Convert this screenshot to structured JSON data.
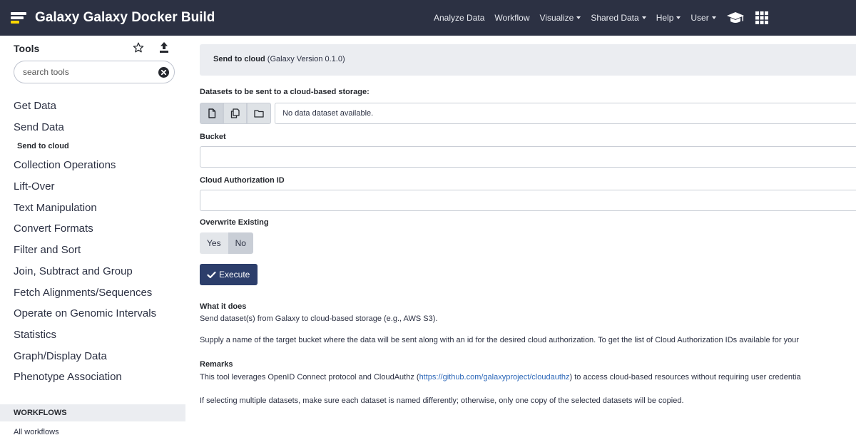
{
  "topbar": {
    "title": "Galaxy Galaxy Docker Build",
    "logo_colors": [
      "#ffd700",
      "#ffffff",
      "#ffffff",
      "#d7d7d7"
    ],
    "nav": [
      {
        "label": "Analyze Data",
        "dropdown": false
      },
      {
        "label": "Workflow",
        "dropdown": false
      },
      {
        "label": "Visualize",
        "dropdown": true
      },
      {
        "label": "Shared Data",
        "dropdown": true
      },
      {
        "label": "Help",
        "dropdown": true
      },
      {
        "label": "User",
        "dropdown": true
      }
    ],
    "icons": [
      "graduation-cap-icon",
      "grid-icon"
    ],
    "background": "#2c3143"
  },
  "tool_panel": {
    "heading": "Tools",
    "search_placeholder": "search tools",
    "categories": [
      {
        "label": "Get Data"
      },
      {
        "label": "Send Data"
      },
      {
        "label": "Send to cloud",
        "sub": true
      },
      {
        "label": "Collection Operations"
      },
      {
        "label": "Lift-Over"
      },
      {
        "label": "Text Manipulation"
      },
      {
        "label": "Convert Formats"
      },
      {
        "label": "Filter and Sort"
      },
      {
        "label": "Join, Subtract and Group"
      },
      {
        "label": "Fetch Alignments/Sequences"
      },
      {
        "label": "Operate on Genomic Intervals"
      },
      {
        "label": "Statistics"
      },
      {
        "label": "Graph/Display Data"
      },
      {
        "label": "Phenotype Association"
      }
    ],
    "workflows_heading": "WORKFLOWS",
    "all_workflows": "All workflows"
  },
  "tool_form": {
    "name": "Send to cloud",
    "version": "(Galaxy Version 0.1.0)",
    "datasets_label": "Datasets to be sent to a cloud-based storage:",
    "datasets_value": "No data dataset available.",
    "bucket_label": "Bucket",
    "bucket_value": "",
    "auth_label": "Cloud Authorization ID",
    "auth_value": "",
    "overwrite_label": "Overwrite Existing",
    "overwrite_yes": "Yes",
    "overwrite_no": "No",
    "overwrite_selected": "No",
    "execute_label": "Execute",
    "execute_color": "#2c3e6b"
  },
  "help": {
    "what_heading": "What it does",
    "what_text": "Send dataset(s) from Galaxy to cloud-based storage (e.g., AWS S3).",
    "supply_text": "Supply a name of the target bucket where the data will be sent along with an id for the desired cloud authorization. To get the list of Cloud Authorization IDs available for your",
    "remarks_heading": "Remarks",
    "remarks_before": "This tool leverages OpenID Connect protocol and CloudAuthz (",
    "remarks_link": "https://github.com/galaxyproject/cloudauthz",
    "remarks_after": ") to access cloud-based resources without requiring user credentia",
    "multiple_text": "If selecting multiple datasets, make sure each dataset is named differently; otherwise, only one copy of the selected datasets will be copied."
  }
}
